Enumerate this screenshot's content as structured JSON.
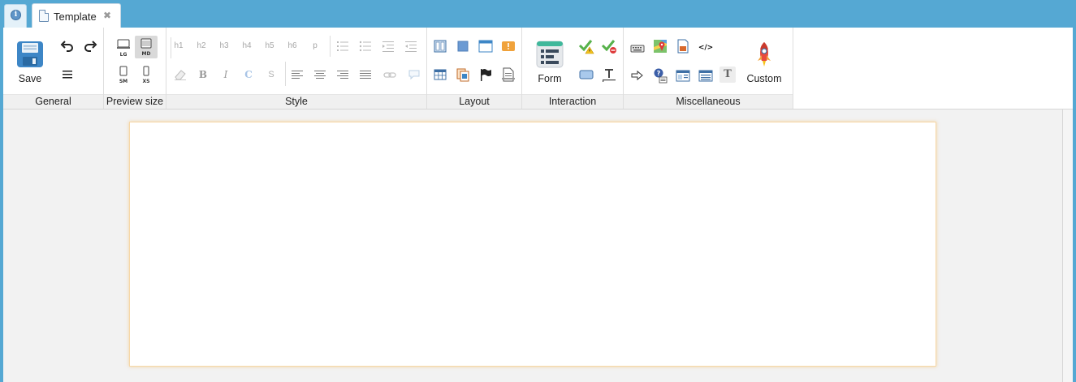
{
  "tabs": {
    "info_icon": "info-icon",
    "document": {
      "label": "Template",
      "close_glyph": "✖",
      "icon": "file-icon"
    }
  },
  "ribbon": {
    "general": {
      "title": "General",
      "save_label": "Save",
      "icons": [
        "save-icon",
        "undo-icon",
        "redo-icon",
        "wrap-icon"
      ]
    },
    "preview_size": {
      "title": "Preview size",
      "sizes": [
        "LG",
        "MD",
        "SM",
        "XS"
      ],
      "selected": "MD"
    },
    "style": {
      "title": "Style",
      "headings": [
        "h1",
        "h2",
        "h3",
        "h4",
        "h5",
        "h6",
        "p"
      ],
      "formatting": [
        "B",
        "I",
        "C",
        "S"
      ],
      "icons": [
        "ordered-list-icon",
        "unordered-list-icon",
        "indent-icon",
        "outdent-icon",
        "eraser-icon",
        "align-left-icon",
        "align-center-icon",
        "align-right-icon",
        "align-justify-icon",
        "link-icon",
        "comment-icon"
      ]
    },
    "layout": {
      "title": "Layout",
      "icons": [
        "columns-icon",
        "block-icon",
        "window-icon",
        "alert-icon",
        "table-icon",
        "tabs-icon",
        "flag-icon",
        "page-break-icon"
      ]
    },
    "interaction": {
      "title": "Interaction",
      "form_label": "Form",
      "icons": [
        "form-icon",
        "check-warning-icon",
        "check-error-icon",
        "button-icon",
        "text-field-icon"
      ]
    },
    "miscellaneous": {
      "title": "Miscellaneous",
      "custom_label": "Custom",
      "text_glyph": "T",
      "code_glyph": "</>",
      "icons": [
        "keyboard-icon",
        "map-icon",
        "image-icon",
        "code-icon",
        "arrow-right-icon",
        "help-icon",
        "panel-icon",
        "list-panel-icon",
        "text-icon",
        "rocket-icon"
      ]
    }
  },
  "colors": {
    "tabbar": "#55a8d3",
    "canvas_border": "#f6d8a8",
    "accent_blue": "#3d86c6"
  }
}
